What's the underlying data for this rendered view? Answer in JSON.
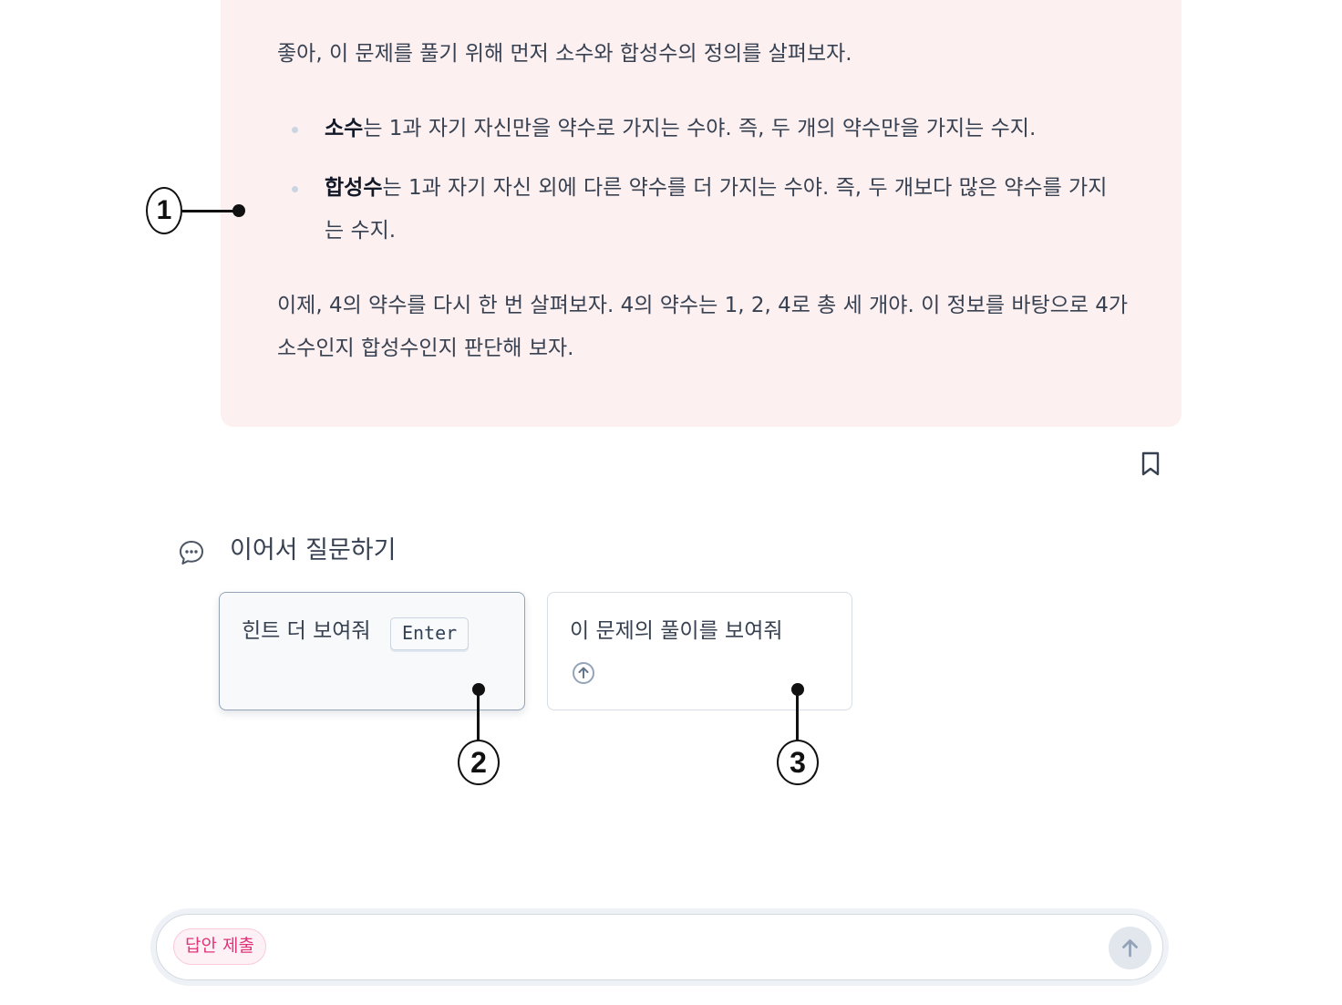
{
  "message": {
    "intro": "좋아, 이 문제를 풀기 위해 먼저 소수와 합성수의 정의를 살펴보자.",
    "bullets": [
      {
        "term": "소수",
        "text": "는 1과 자기 자신만을 약수로 가지는 수야. 즉, 두 개의 약수만을 가지는 수지."
      },
      {
        "term": "합성수",
        "text": "는 1과 자기 자신 외에 다른 약수를 더 가지는 수야. 즉, 두 개보다 많은 약수를 가지는 수지."
      }
    ],
    "conclusion": "이제, 4의 약수를 다시 한 번 살펴보자. 4의 약수는 1, 2, 4로 총 세 개야. 이 정보를 바탕으로 4가 소수인지 합성수인지 판단해 보자."
  },
  "followup": {
    "title": "이어서 질문하기",
    "icon": "chat-bubble-icon",
    "suggestions": [
      {
        "label": "힌트 더 보여줘",
        "shortcut": "Enter"
      },
      {
        "label": "이 문제의 풀이를 보여줘",
        "icon": "arrow-up-circle-icon"
      }
    ]
  },
  "composer": {
    "chip_label": "답안 제출",
    "placeholder": "",
    "send_icon": "arrow-up-icon"
  },
  "annotations": {
    "one": "1",
    "two": "2",
    "three": "3"
  },
  "colors": {
    "message_bg": "#fcf0f0",
    "chip_text": "#e0357a",
    "chip_bg": "#fdf1f5"
  }
}
